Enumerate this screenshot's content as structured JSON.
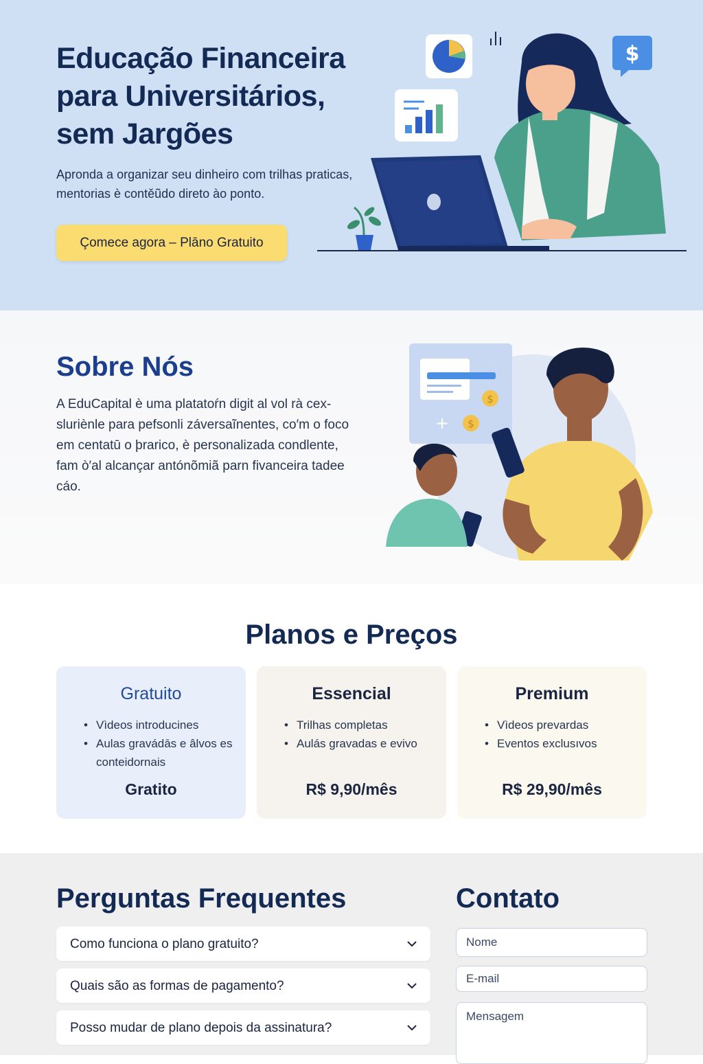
{
  "hero": {
    "title": "Educação Financeira para Universitários, sem Jargões",
    "subtitle": "Apronda a organizar seu dinheiro com trilhas praticas, mentorias è contěũdo direto ào ponto.",
    "cta_label": "Çomece agora – Plāno Gratuito"
  },
  "about": {
    "title": "Sobre Nós",
    "text": "A EduCapital è uma platatoŕn digit al vol rà cex-sluriènle para pefsonli záversaĩnentes, co′m o foco em centatū o þrarico, è personalizada condlente, fam ò′al alcançar antónõmiã parn fivanceira tadee cáo."
  },
  "pricing": {
    "title": "Planos e Preços",
    "plans": [
      {
        "name": "Gratuito",
        "features": [
          "Vìdeos introducines",
          "Aulas gravádās e âlvos es conteidornais"
        ],
        "price": "Gratito"
      },
      {
        "name": "Essencial",
        "features": [
          "Trilhas completas",
          "Aulás gravadas e evivo"
        ],
        "price": "R$ 9,90/mês"
      },
      {
        "name": "Premium",
        "features": [
          "Vìdeos prevardas",
          "Eventos exclusıvos"
        ],
        "price": "R$ 29,90/mês"
      }
    ]
  },
  "faq": {
    "title": "Perguntas Frequentes",
    "items": [
      {
        "question": "Como funciona o plano gratuito?"
      },
      {
        "question": "Quais são as formas de pagamento?"
      },
      {
        "question": "Posso mudar de plano depois da assinatura?"
      }
    ]
  },
  "contact": {
    "title": "Contato",
    "name_placeholder": "Nome",
    "email_placeholder": "E-mail",
    "message_placeholder": "Mensagem"
  },
  "icons": {
    "hero": [
      "pie-chart-icon",
      "bar-chart-icon",
      "dollar-chat-icon",
      "laptop-icon",
      "plant-icon"
    ],
    "about": [
      "phone-icon",
      "coin-icon",
      "document-card-icon"
    ],
    "faq": "chevron-down-icon"
  },
  "colors": {
    "hero_bg": "#cfdff4",
    "cta_bg": "#fbdc71",
    "heading_navy": "#132a55",
    "about_title_blue": "#1b3f8e",
    "card_free": "#e9effa",
    "card_essential": "#f6f2ed",
    "card_premium": "#fbf8ef",
    "faq_bg": "#efefef"
  }
}
